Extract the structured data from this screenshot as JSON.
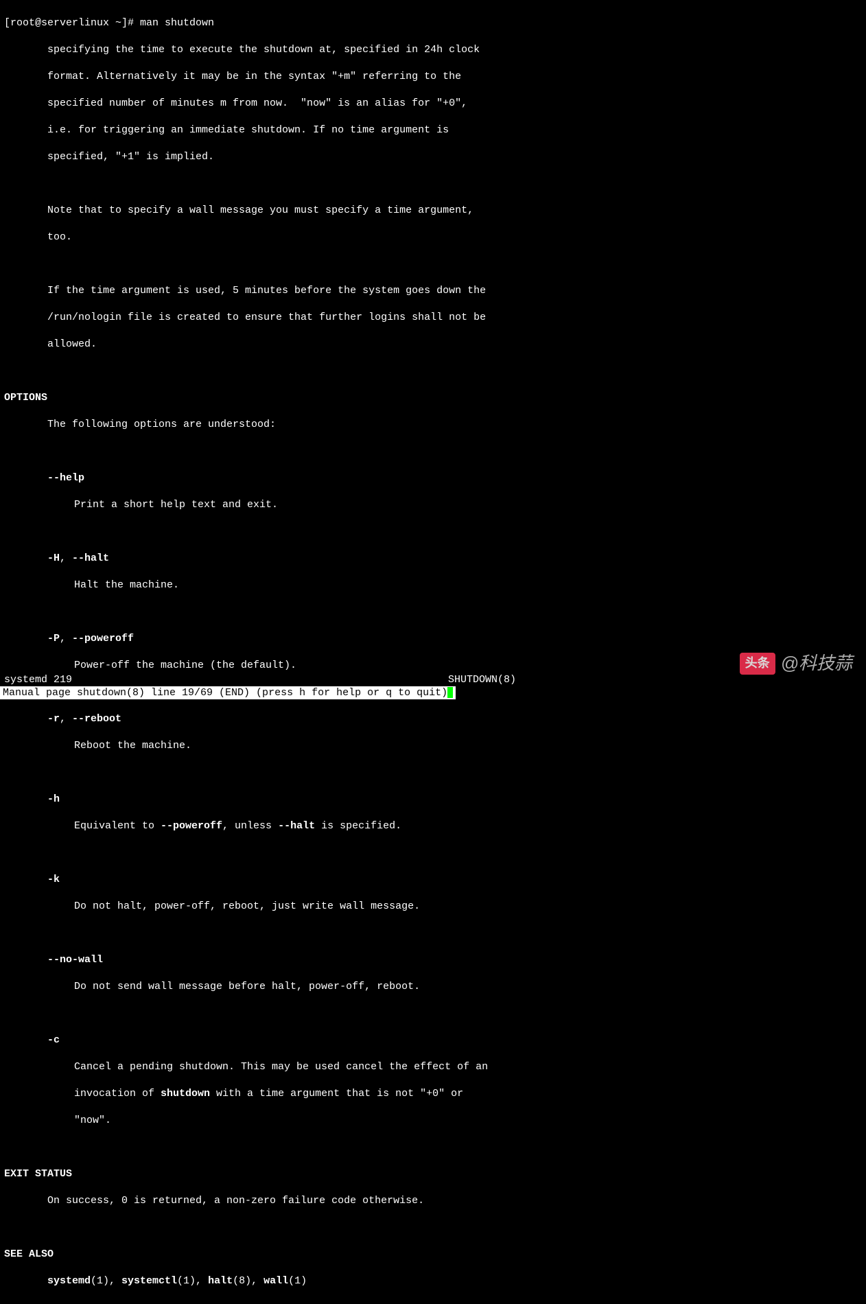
{
  "prompt": "[root@serverlinux ~]# man shutdown",
  "desc_para1": [
    "specifying the time to execute the shutdown at, specified in 24h clock",
    "format. Alternatively it may be in the syntax \"+m\" referring to the",
    "specified number of minutes m from now.  \"now\" is an alias for \"+0\",",
    "i.e. for triggering an immediate shutdown. If no time argument is",
    "specified, \"+1\" is implied."
  ],
  "desc_para2": [
    "Note that to specify a wall message you must specify a time argument,",
    "too."
  ],
  "desc_para3": [
    "If the time argument is used, 5 minutes before the system goes down the",
    "/run/nologin file is created to ensure that further logins shall not be",
    "allowed."
  ],
  "options_header": "OPTIONS",
  "options_intro": "The following options are understood:",
  "opts": {
    "help": {
      "flag": "--help",
      "desc": "Print a short help text and exit."
    },
    "halt": {
      "flag": "-H",
      "flag2": "--halt",
      "desc": "Halt the machine."
    },
    "poweroff": {
      "flag": "-P",
      "flag2": "--poweroff",
      "desc": "Power-off the machine (the default)."
    },
    "reboot": {
      "flag": "-r",
      "flag2": "--reboot",
      "desc": "Reboot the machine."
    },
    "h": {
      "flag": "-h",
      "desc_pre": "Equivalent to ",
      "desc_b1": "--poweroff",
      "desc_mid": ", unless ",
      "desc_b2": "--halt",
      "desc_post": " is specified."
    },
    "k": {
      "flag": "-k",
      "desc": "Do not halt, power-off, reboot, just write wall message."
    },
    "nowall": {
      "flag": "--no-wall",
      "desc": "Do not send wall message before halt, power-off, reboot."
    },
    "c": {
      "flag": "-c",
      "line1_pre": "Cancel a pending shutdown. This may be used cancel the effect of an",
      "line2_pre": "invocation of ",
      "line2_b": "shutdown",
      "line2_post": " with a time argument that is not \"+0\" or",
      "line3": "\"now\"."
    }
  },
  "exit_header": "EXIT STATUS",
  "exit_text": "On success, 0 is returned, a non-zero failure code otherwise.",
  "seealso_header": "SEE ALSO",
  "seealso": {
    "a1": "systemd",
    "n1": "(1), ",
    "a2": "systemctl",
    "n2": "(1), ",
    "a3": "halt",
    "n3": "(8), ",
    "a4": "wall",
    "n4": "(1)"
  },
  "footer_left": "systemd 219",
  "footer_right": "SHUTDOWN(8)",
  "status": " Manual page shutdown(8) line 19/69 (END) (press h for help or q to quit)",
  "watermark": {
    "logo": "头条",
    "text": "@科技蒜"
  }
}
